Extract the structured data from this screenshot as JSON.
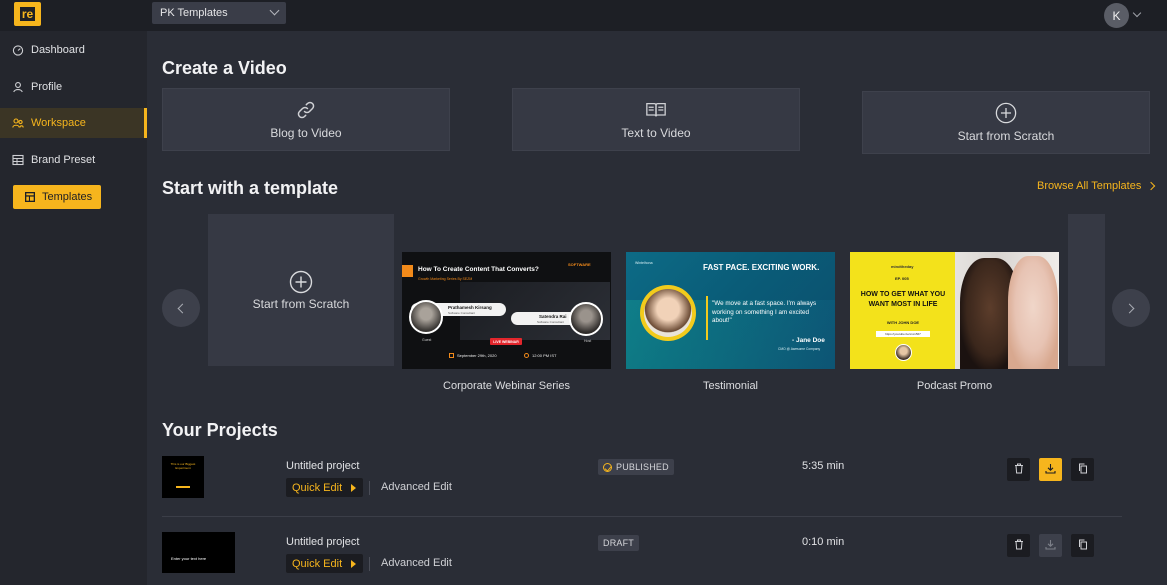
{
  "app": {
    "logo_text": "re",
    "workspace_select": "PK Templates",
    "avatar_initial": "K"
  },
  "sidebar": {
    "items": [
      {
        "label": "Dashboard",
        "icon": "dashboard-icon"
      },
      {
        "label": "Profile",
        "icon": "user-icon"
      },
      {
        "label": "Workspace",
        "icon": "workspace-icon",
        "active": true
      },
      {
        "label": "Brand Preset",
        "icon": "brand-preset-icon"
      }
    ],
    "templates_button": "Templates"
  },
  "create_video": {
    "heading": "Create a Video",
    "cards": [
      {
        "label": "Blog to Video",
        "icon": "link-icon"
      },
      {
        "label": "Text to Video",
        "icon": "book-icon"
      },
      {
        "label": "Start from Scratch",
        "icon": "plus-circle-icon"
      }
    ]
  },
  "templates": {
    "heading": "Start with a template",
    "browse_all": "Browse All Templates",
    "scratch_label": "Start from Scratch",
    "items": [
      {
        "label": "Corporate Webinar Series",
        "thumb": {
          "headline": "How To Create Content That Converts?",
          "subline": "Growth Marketing Series By SEZM",
          "brand": "SOFTWARE",
          "speaker1": "Prathamesh Kirsang",
          "speaker1_role": "Software Consultant",
          "speaker1_tag": "Guest",
          "speaker2": "Satendra Rai",
          "speaker2_role": "Software Consultant",
          "speaker2_tag": "Host",
          "badge": "LIVE WEBINAR",
          "date": "September 29th, 2020",
          "time": "12:00 PM IST"
        }
      },
      {
        "label": "Testimonial",
        "thumb": {
          "brand": "Wintelhona",
          "headline": "FAST PACE. EXCITING WORK.",
          "quote": "\"We move at a fast space. I'm always working on something I am excited about!\"",
          "author": "- Jane Doe",
          "author_role": "CMO @ Awesome Company"
        }
      },
      {
        "label": "Podcast Promo",
        "thumb": {
          "brand": "mindtheday",
          "episode": "EP. 005",
          "headline_line1": "HOW TO GET WHAT YOU",
          "headline_line2": "WANT MOST IN LIFE",
          "guest": "WITH JOHN DOE",
          "link": "https://youtube.be/xxxx567"
        }
      }
    ]
  },
  "projects": {
    "heading": "Your Projects",
    "rows": [
      {
        "title": "Untitled project",
        "quick_edit": "Quick Edit",
        "advanced_edit": "Advanced Edit",
        "status": "PUBLISHED",
        "duration": "5:35 min",
        "thumb_text": "This is our Biggest Experiment",
        "download_enabled": true
      },
      {
        "title": "Untitled project",
        "quick_edit": "Quick Edit",
        "advanced_edit": "Advanced Edit",
        "status": "DRAFT",
        "duration": "0:10 min",
        "thumb_text": "Enter your text here",
        "download_enabled": false
      }
    ]
  },
  "colors": {
    "accent": "#f6b51d",
    "bg": "#2a2d36",
    "sidebar": "#24262d",
    "card": "#363944"
  }
}
